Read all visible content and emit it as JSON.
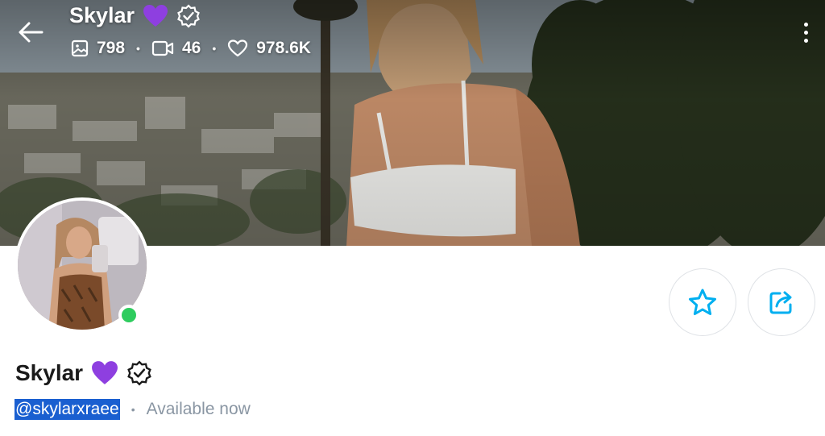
{
  "header": {
    "name": "Skylar",
    "stats": {
      "photos": "798",
      "videos": "46",
      "likes": "978.6K"
    }
  },
  "profile": {
    "name": "Skylar",
    "handle": "@skylarxraee",
    "status": "Available now"
  },
  "icons": {
    "back": "arrow-left-icon",
    "more": "more-vertical-icon",
    "favorite": "star-icon",
    "share": "share-icon",
    "photo": "image-icon",
    "video": "video-camera-icon",
    "like": "heart-icon",
    "verified": "verified-badge-icon",
    "heart_emoji": "purple-heart-icon"
  },
  "colors": {
    "accent": "#00aff0",
    "online": "#2ecc5e",
    "muted": "#8a96a3",
    "purple_heart": "#8e3fe0"
  }
}
